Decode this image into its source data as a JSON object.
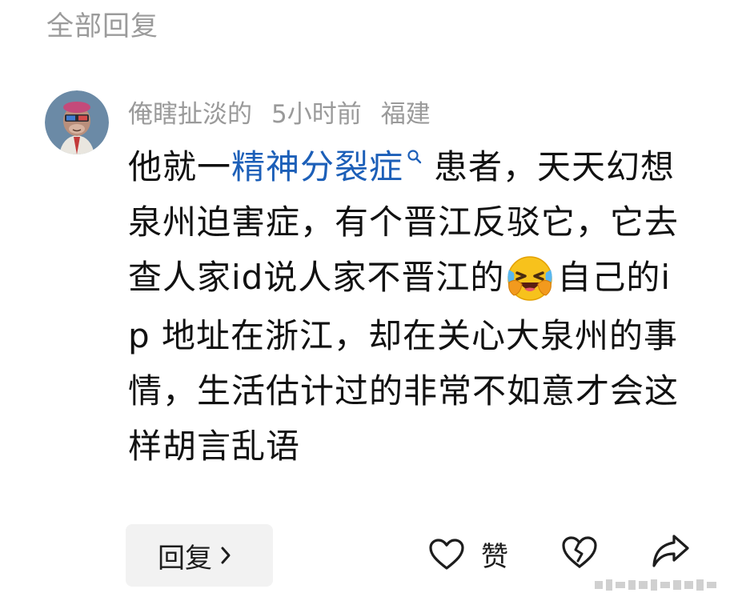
{
  "section": {
    "title": "全部回复"
  },
  "comment": {
    "author": "俺瞎扯淡的",
    "time": "5小时前",
    "location": "福建",
    "text_before_link": "他就一",
    "topic_link": "精神分裂症",
    "text_after_link": "患者，天天幻想泉州迫害症，有个晋江反驳它，它去查人家id说人家不晋江的",
    "emoji": "laughing-crying-emoji",
    "text_after_emoji": "自己的i p 地址在浙江，却在关心大泉州的事情，生活估计过的非常不如意才会这样胡言乱语"
  },
  "actions": {
    "reply_label": "回复",
    "like_label": "赞"
  },
  "colors": {
    "link": "#1c5fb8",
    "muted": "#9a9a9a",
    "button_bg": "#f2f2f2"
  }
}
